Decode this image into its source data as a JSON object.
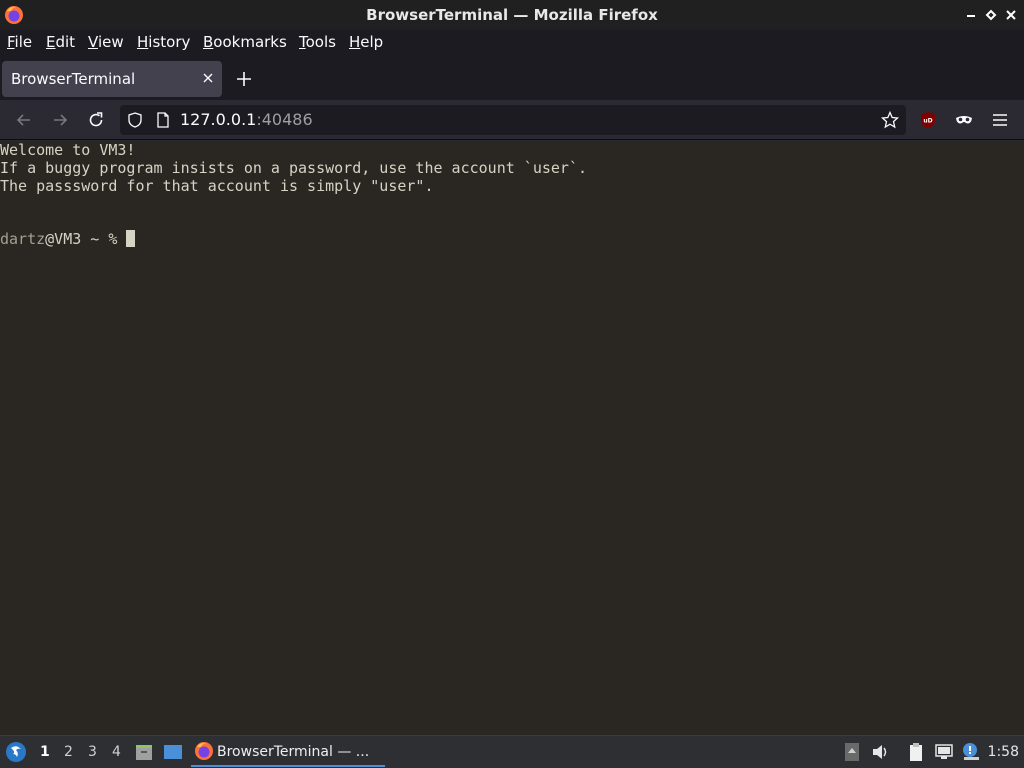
{
  "window": {
    "title": "BrowserTerminal — Mozilla Firefox"
  },
  "menubar": {
    "items": [
      {
        "label_rest": "ile",
        "mnemonic": "F"
      },
      {
        "label_rest": "dit",
        "mnemonic": "E"
      },
      {
        "label_rest": "iew",
        "mnemonic": "V"
      },
      {
        "label_rest": "istory",
        "mnemonic": "H",
        "prefix": ""
      },
      {
        "label_rest": "ookmarks",
        "mnemonic": "B"
      },
      {
        "label_rest": "ools",
        "mnemonic": "T"
      },
      {
        "label_rest": "elp",
        "mnemonic": "H"
      }
    ],
    "labels": [
      "File",
      "Edit",
      "View",
      "History",
      "Bookmarks",
      "Tools",
      "Help"
    ]
  },
  "tab": {
    "label": "BrowserTerminal"
  },
  "urlbar": {
    "host": "127.0.0.1",
    "port": ":40486"
  },
  "terminal": {
    "lines": [
      "Welcome to VM3!",
      "If a buggy program insists on a password, use the account `user`.",
      "The passsword for that account is simply \"user\"."
    ],
    "prompt_user": "dartz",
    "prompt_rest": "@VM3 ~ % "
  },
  "taskbar": {
    "workspaces": [
      "1",
      "2",
      "3",
      "4"
    ],
    "active_workspace": "1",
    "task_label": "BrowserTerminal — ...",
    "clock": "1:58"
  },
  "colors": {
    "terminal_bg": "#2a2723",
    "terminal_fg": "#d6d2c4",
    "firefox_chrome": "#1c1b22",
    "taskbar_bg": "#2d2f33",
    "task_underline": "#4a90d9"
  }
}
